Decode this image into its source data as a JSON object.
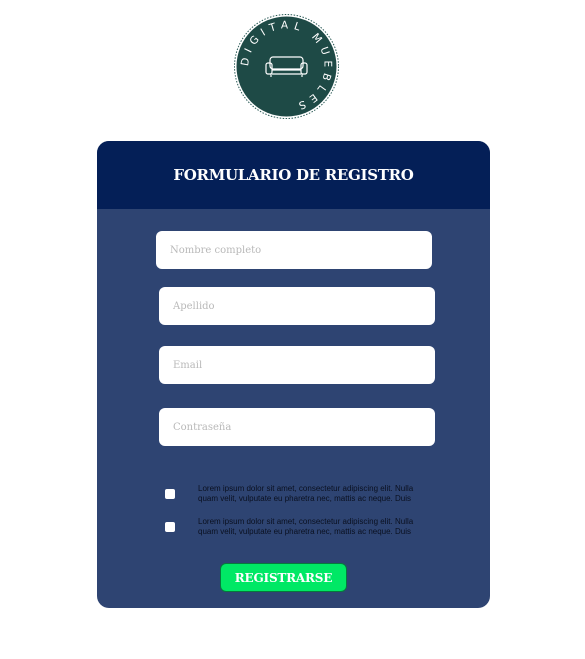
{
  "logo": {
    "text": "DIGITAL MUEBLES",
    "icon": "sofa-icon",
    "bg_color": "#1e4a46"
  },
  "form": {
    "title": "FORMULARIO DE REGISTRO",
    "fields": [
      {
        "placeholder": "Nombre completo",
        "value": ""
      },
      {
        "placeholder": "Apellido",
        "value": ""
      },
      {
        "placeholder": "Email",
        "value": ""
      },
      {
        "placeholder": "Contraseña",
        "value": ""
      }
    ],
    "checkboxes": [
      {
        "label": "Lorem ipsum dolor sit amet, consectetur adipiscing elit. Nulla quam velit, vulputate eu pharetra nec, mattis ac neque. Duis",
        "checked": false
      },
      {
        "label": "Lorem ipsum dolor sit amet, consectetur adipiscing elit. Nulla quam velit, vulputate eu pharetra nec, mattis ac neque. Duis",
        "checked": false
      }
    ],
    "submit_label": "REGISTRARSE"
  },
  "colors": {
    "header": "#041f57",
    "card": "#2e4472",
    "button": "#00e865"
  }
}
